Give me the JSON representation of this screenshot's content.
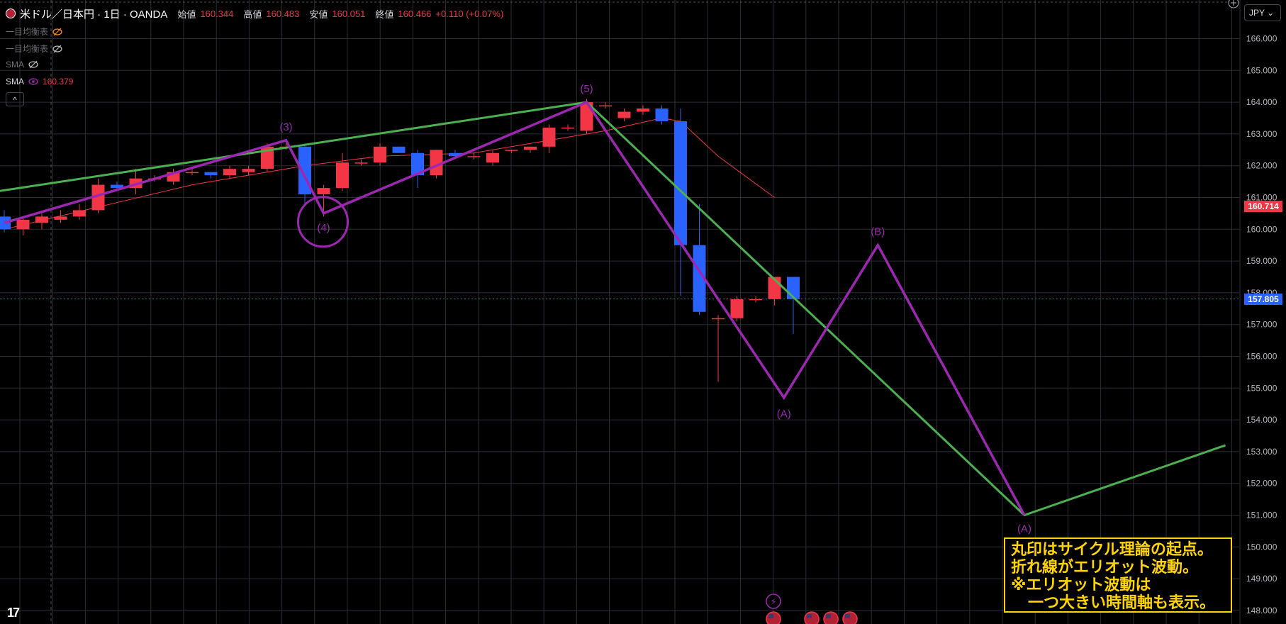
{
  "header": {
    "symbol": "米ドル／日本円 · 1日 · OANDA",
    "ohlc": [
      {
        "label": "始値",
        "value": "160.344"
      },
      {
        "label": "高値",
        "value": "160.483"
      },
      {
        "label": "安値",
        "value": "160.051"
      },
      {
        "label": "終値",
        "value": "160.466"
      }
    ],
    "change": "+0.110 (+0.07%)"
  },
  "indicators": [
    {
      "name": "一目均衡表",
      "visible": false
    },
    {
      "name": "一目均衡表",
      "visible": false
    },
    {
      "name": "SMA",
      "visible": false
    },
    {
      "name": "SMA",
      "value": "160.379",
      "visible": true
    }
  ],
  "collapse_label": "^",
  "currency": "JPY ⌄",
  "note": {
    "lines": [
      "丸印はサイクル理論の起点。",
      "折れ線がエリオット波動。",
      "※エリオット波動は",
      "一つ大きい時間軸も表示。"
    ]
  },
  "colors": {
    "up": "#f23645",
    "down": "#2962ff",
    "wave": "#9c27b0",
    "trend": "#4caf50",
    "sma": "#f23645",
    "note": "#ffd400"
  },
  "chart_data": {
    "type": "candlestick",
    "y_ticks": [
      "166.000",
      "165.000",
      "164.000",
      "163.000",
      "162.000",
      "161.000",
      "160.000",
      "159.000",
      "158.000",
      "157.000",
      "156.000",
      "155.000",
      "154.000",
      "153.000",
      "152.000",
      "151.000",
      "150.000",
      "149.000",
      "148.000"
    ],
    "ylim": [
      148.0,
      166.0
    ],
    "price_labels": [
      {
        "value": 160.714,
        "text": "160.714",
        "color": "#f23645"
      },
      {
        "value": 157.805,
        "text": "157.805",
        "color": "#2962ff"
      }
    ],
    "candles": [
      {
        "i": 0,
        "o": 160.4,
        "h": 160.6,
        "l": 159.9,
        "c": 160.0
      },
      {
        "i": 1,
        "o": 160.0,
        "h": 160.4,
        "l": 159.8,
        "c": 160.3
      },
      {
        "i": 2,
        "o": 160.2,
        "h": 160.5,
        "l": 160.0,
        "c": 160.4
      },
      {
        "i": 3,
        "o": 160.3,
        "h": 160.6,
        "l": 160.2,
        "c": 160.4
      },
      {
        "i": 4,
        "o": 160.4,
        "h": 160.8,
        "l": 160.3,
        "c": 160.6
      },
      {
        "i": 5,
        "o": 160.6,
        "h": 161.6,
        "l": 160.5,
        "c": 161.4
      },
      {
        "i": 6,
        "o": 161.4,
        "h": 161.5,
        "l": 161.2,
        "c": 161.3
      },
      {
        "i": 7,
        "o": 161.3,
        "h": 161.9,
        "l": 161.1,
        "c": 161.6
      },
      {
        "i": 8,
        "o": 161.6,
        "h": 161.7,
        "l": 161.5,
        "c": 161.6
      },
      {
        "i": 9,
        "o": 161.5,
        "h": 161.9,
        "l": 161.4,
        "c": 161.8
      },
      {
        "i": 10,
        "o": 161.8,
        "h": 161.9,
        "l": 161.7,
        "c": 161.8
      },
      {
        "i": 11,
        "o": 161.8,
        "h": 161.8,
        "l": 161.6,
        "c": 161.7
      },
      {
        "i": 12,
        "o": 161.7,
        "h": 162.0,
        "l": 161.6,
        "c": 161.9
      },
      {
        "i": 13,
        "o": 161.8,
        "h": 162.0,
        "l": 161.7,
        "c": 161.9
      },
      {
        "i": 14,
        "o": 161.9,
        "h": 162.7,
        "l": 161.8,
        "c": 162.6
      },
      {
        "i": 15,
        "o": 162.6,
        "h": 162.7,
        "l": 162.5,
        "c": 162.6
      },
      {
        "i": 16,
        "o": 162.6,
        "h": 162.7,
        "l": 160.8,
        "c": 161.1
      },
      {
        "i": 17,
        "o": 161.1,
        "h": 161.4,
        "l": 160.4,
        "c": 161.3
      },
      {
        "i": 18,
        "o": 161.3,
        "h": 162.4,
        "l": 161.2,
        "c": 162.1
      },
      {
        "i": 19,
        "o": 162.1,
        "h": 162.2,
        "l": 162.0,
        "c": 162.1
      },
      {
        "i": 20,
        "o": 162.1,
        "h": 162.7,
        "l": 162.0,
        "c": 162.6
      },
      {
        "i": 21,
        "o": 162.6,
        "h": 162.6,
        "l": 162.4,
        "c": 162.4
      },
      {
        "i": 22,
        "o": 162.4,
        "h": 162.5,
        "l": 161.3,
        "c": 161.7
      },
      {
        "i": 23,
        "o": 161.7,
        "h": 162.5,
        "l": 161.6,
        "c": 162.5
      },
      {
        "i": 24,
        "o": 162.4,
        "h": 162.5,
        "l": 162.2,
        "c": 162.3
      },
      {
        "i": 25,
        "o": 162.3,
        "h": 162.4,
        "l": 162.2,
        "c": 162.3
      },
      {
        "i": 26,
        "o": 162.1,
        "h": 162.5,
        "l": 162.0,
        "c": 162.4
      },
      {
        "i": 27,
        "o": 162.5,
        "h": 162.5,
        "l": 162.4,
        "c": 162.5
      },
      {
        "i": 28,
        "o": 162.5,
        "h": 162.6,
        "l": 162.4,
        "c": 162.6
      },
      {
        "i": 29,
        "o": 162.6,
        "h": 163.3,
        "l": 162.4,
        "c": 163.2
      },
      {
        "i": 30,
        "o": 163.2,
        "h": 163.3,
        "l": 163.1,
        "c": 163.2
      },
      {
        "i": 31,
        "o": 163.1,
        "h": 164.1,
        "l": 163.0,
        "c": 164.0
      },
      {
        "i": 32,
        "o": 163.9,
        "h": 164.0,
        "l": 163.8,
        "c": 163.9
      },
      {
        "i": 33,
        "o": 163.5,
        "h": 163.8,
        "l": 163.4,
        "c": 163.7
      },
      {
        "i": 34,
        "o": 163.7,
        "h": 163.9,
        "l": 163.6,
        "c": 163.8
      },
      {
        "i": 35,
        "o": 163.8,
        "h": 163.9,
        "l": 163.3,
        "c": 163.4
      },
      {
        "i": 36,
        "o": 163.4,
        "h": 163.8,
        "l": 157.9,
        "c": 159.5
      },
      {
        "i": 37,
        "o": 159.5,
        "h": 160.8,
        "l": 157.3,
        "c": 157.4
      },
      {
        "i": 38,
        "o": 157.2,
        "h": 157.3,
        "l": 155.2,
        "c": 157.2
      },
      {
        "i": 39,
        "o": 157.2,
        "h": 157.9,
        "l": 157.1,
        "c": 157.8
      },
      {
        "i": 40,
        "o": 157.8,
        "h": 157.9,
        "l": 157.7,
        "c": 157.8
      },
      {
        "i": 41,
        "o": 157.8,
        "h": 158.5,
        "l": 157.6,
        "c": 158.5
      },
      {
        "i": 42,
        "o": 158.5,
        "h": 158.5,
        "l": 156.7,
        "c": 157.8
      }
    ],
    "sma": [
      {
        "i": 0,
        "v": 160.0
      },
      {
        "i": 5,
        "v": 160.7
      },
      {
        "i": 10,
        "v": 161.4
      },
      {
        "i": 14,
        "v": 161.8
      },
      {
        "i": 16,
        "v": 162.0
      },
      {
        "i": 20,
        "v": 162.3
      },
      {
        "i": 25,
        "v": 162.4
      },
      {
        "i": 29,
        "v": 162.8
      },
      {
        "i": 32,
        "v": 163.1
      },
      {
        "i": 35,
        "v": 163.5
      },
      {
        "i": 36,
        "v": 163.4
      },
      {
        "i": 38,
        "v": 162.3
      },
      {
        "i": 41,
        "v": 161.0
      }
    ],
    "elliott_wave": [
      {
        "i": 0,
        "v": 160.2,
        "label": ""
      },
      {
        "i": 15,
        "v": 162.8,
        "label": "(3)"
      },
      {
        "i": 17,
        "v": 160.5,
        "label": "(4)"
      },
      {
        "i": 31,
        "v": 164.0,
        "label": "(5)"
      },
      {
        "i": 41.5,
        "v": 154.7,
        "label": "(A)"
      },
      {
        "i": 46.5,
        "v": 159.5,
        "label": "(B)"
      },
      {
        "i": 54.3,
        "v": 151.0,
        "label": "(A)"
      }
    ],
    "trend_line": [
      {
        "i": -0.3,
        "v": 161.2
      },
      {
        "i": 31,
        "v": 164.0
      },
      {
        "i": 54.3,
        "v": 151.0
      },
      {
        "i": 65,
        "v": 153.2
      }
    ],
    "cycle_circle": {
      "i": 17,
      "v": 160.3
    }
  }
}
